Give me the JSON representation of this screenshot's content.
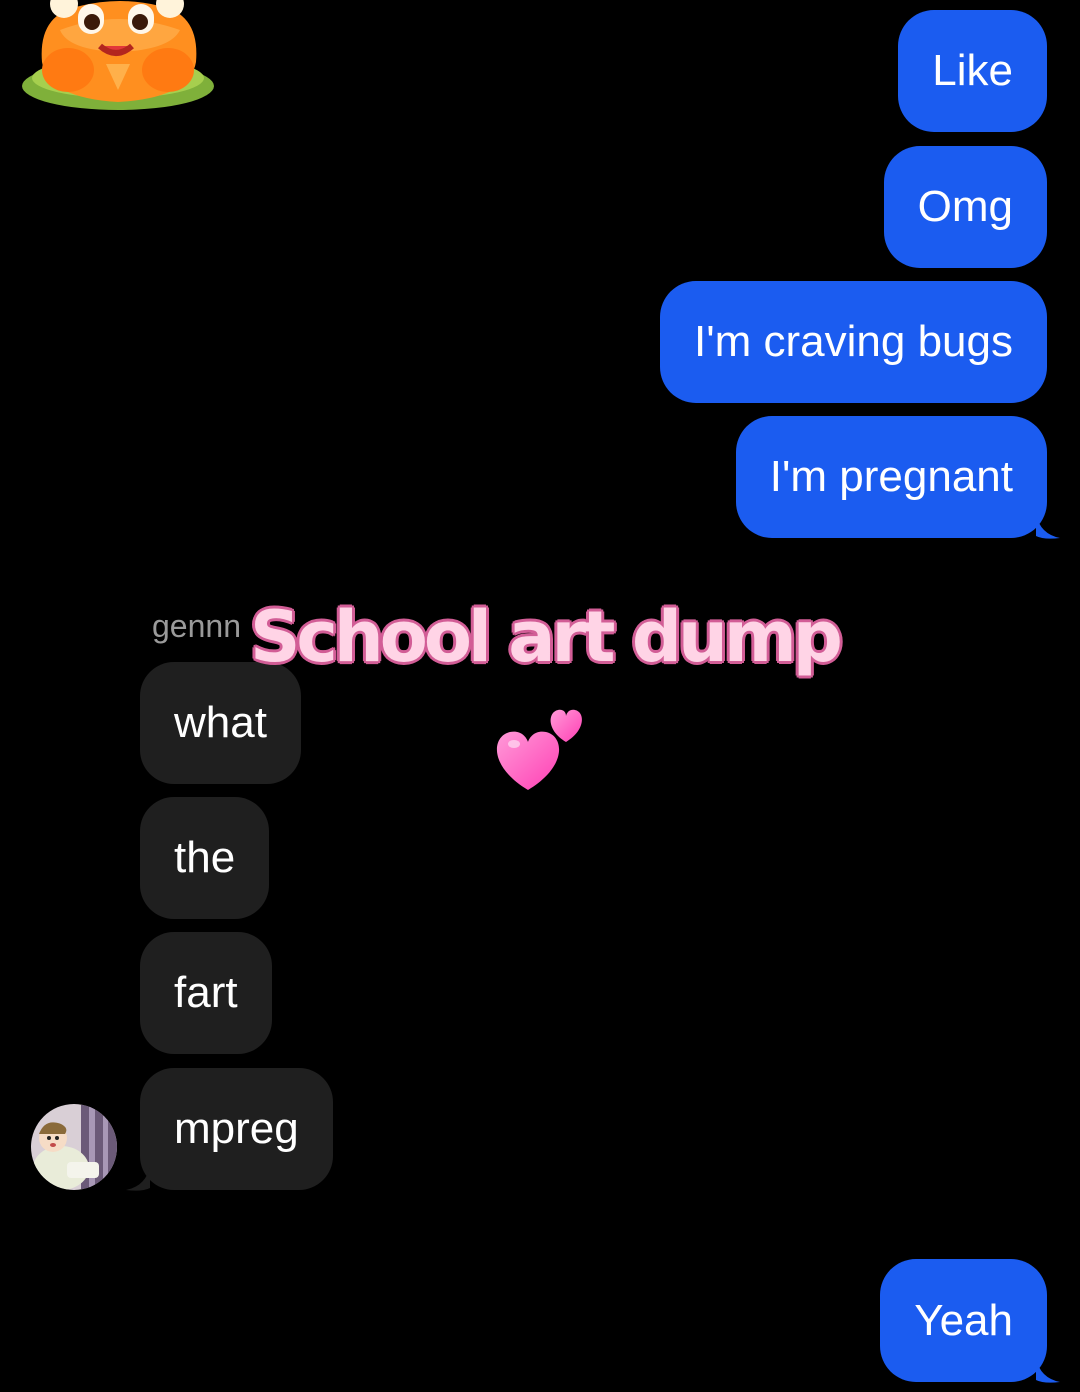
{
  "sticker": {
    "icon": "cartoon-sticker-icon"
  },
  "outgoing_top": [
    {
      "text": "Like"
    },
    {
      "text": "Omg"
    },
    {
      "text": "I'm craving bugs"
    },
    {
      "text": "I'm pregnant"
    }
  ],
  "overlay": {
    "title": "School art dump",
    "icon": "two-hearts-icon"
  },
  "incoming": {
    "sender": "gennn",
    "messages": [
      {
        "text": "what"
      },
      {
        "text": "the"
      },
      {
        "text": "fart"
      },
      {
        "text": "mpreg"
      }
    ],
    "avatar_icon": "anime-avatar-icon"
  },
  "outgoing_bottom": [
    {
      "text": "Yeah"
    }
  ],
  "colors": {
    "background": "#000000",
    "outgoing_bubble": "#1b5cf0",
    "incoming_bubble": "#1f1f1f",
    "overlay_fill": "#ffd4e6",
    "overlay_stroke": "#d25d96"
  }
}
